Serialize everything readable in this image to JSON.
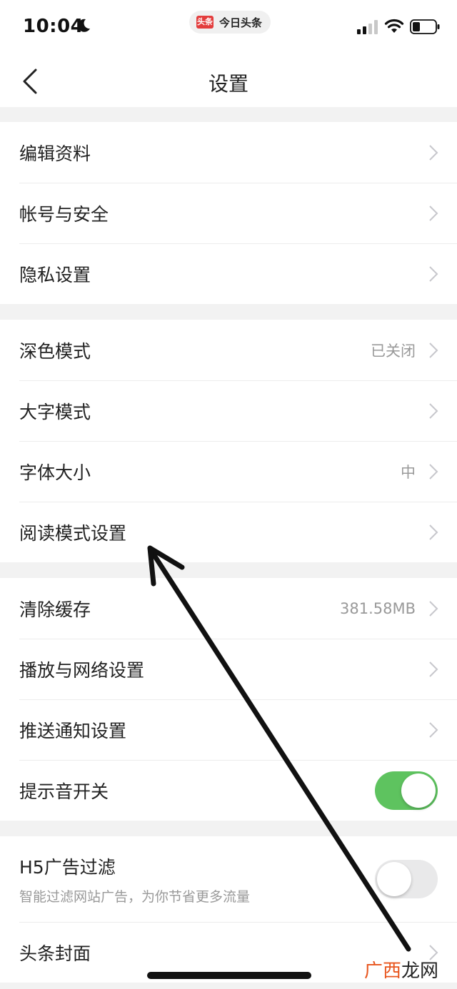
{
  "status_bar": {
    "time": "10:04",
    "app_badge_logo": "头条",
    "app_badge_name": "今日头条"
  },
  "nav": {
    "title": "设置"
  },
  "groups": [
    {
      "rows": [
        {
          "label": "编辑资料"
        },
        {
          "label": "帐号与安全"
        },
        {
          "label": "隐私设置"
        }
      ]
    },
    {
      "rows": [
        {
          "label": "深色模式",
          "value": "已关闭"
        },
        {
          "label": "大字模式"
        },
        {
          "label": "字体大小",
          "value": "中"
        },
        {
          "label": "阅读模式设置"
        }
      ]
    },
    {
      "rows": [
        {
          "label": "清除缓存",
          "value": "381.58MB"
        },
        {
          "label": "播放与网络设置"
        },
        {
          "label": "推送通知设置"
        },
        {
          "label": "提示音开关",
          "toggle": true
        }
      ]
    },
    {
      "rows": [
        {
          "label": "H5广告过滤",
          "subtitle": "智能过滤网站广告，为你节省更多流量",
          "toggle": false
        },
        {
          "label": "头条封面"
        }
      ]
    }
  ],
  "watermark": {
    "part1": "广西",
    "part2": "龙网"
  },
  "colors": {
    "toggle_on": "#5ec35f",
    "toggle_off": "#e9e9ea",
    "brand_red": "#e33d3d"
  },
  "icons": [
    "moon-icon",
    "signal-icon",
    "wifi-icon",
    "battery-icon",
    "back-arrow-icon",
    "chevron-right-icon",
    "annotation-arrow"
  ]
}
